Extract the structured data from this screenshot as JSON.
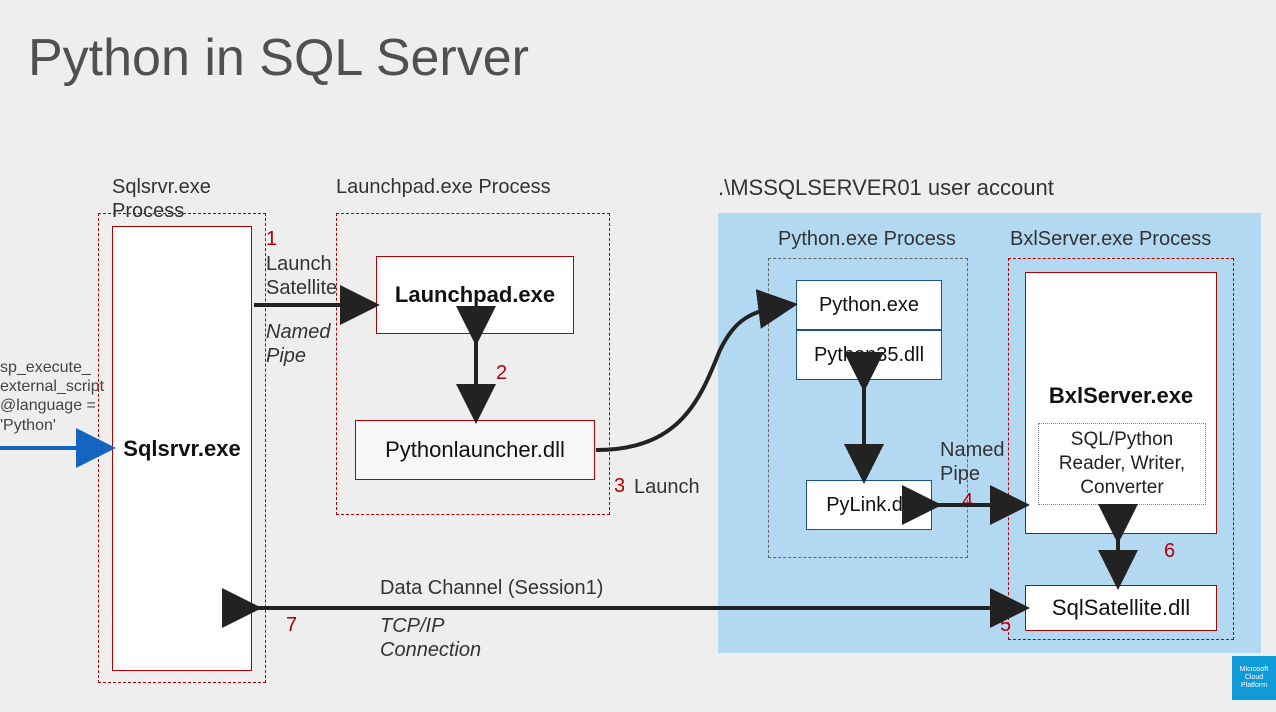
{
  "title": "Python in SQL Server",
  "sql_input": "sp_execute_\nexternal_script\n@language =\n'Python'",
  "groups": {
    "sqlsrvr": "Sqlsrvr.exe\nProcess",
    "launchpad": "Launchpad.exe  Process",
    "user": ".\\MSSQLSERVER01 user account",
    "python": "Python.exe Process",
    "bxl": "BxlServer.exe Process"
  },
  "boxes": {
    "sqlsrvr": "Sqlsrvr.exe",
    "launchpad": "Launchpad.exe",
    "pythonlauncher": "Pythonlauncher.dll",
    "python_exe": "Python.exe",
    "python35": "Python35.dll",
    "pylink": "PyLink.dll",
    "bxlserver": "BxlServer.exe",
    "reader": "SQL/Python\nReader, Writer,\nConverter",
    "sqlsat": "SqlSatellite.dll"
  },
  "steps": {
    "s1": "1",
    "s1_label": "Launch\nSatellite",
    "s1_sub": "Named\nPipe",
    "s2": "2",
    "s3": "3",
    "s3_label": "Launch",
    "s4": "4",
    "s4_label": "Named\nPipe",
    "s5": "5",
    "s6": "6",
    "s7": "7",
    "s7_label": "Data Channel (Session1)",
    "s7_sub": "TCP/IP\nConnection"
  },
  "badge": "Microsoft\nCloud\nPlatform"
}
